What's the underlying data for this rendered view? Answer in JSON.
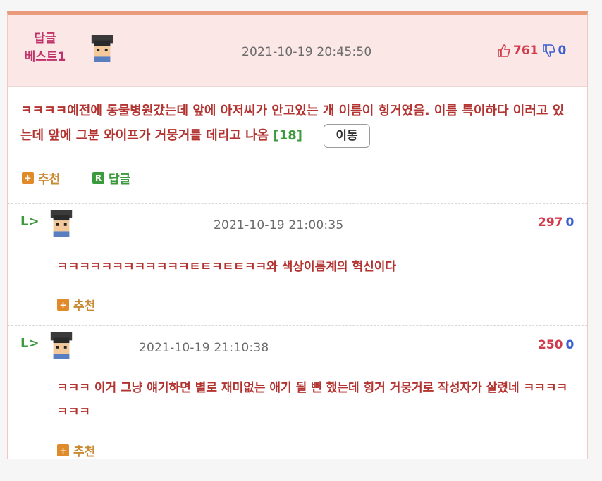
{
  "best_header": {
    "label_line1": "답글",
    "label_line2": "베스트1",
    "timestamp": "2021-10-19 20:45:50",
    "upvotes": "761",
    "downvotes": "0"
  },
  "post": {
    "text": "ㅋㅋㅋㅋ예전에 동물병원갔는데 앞에 아저씨가 안고있는 개 이름이 힝거였음. 이름 특이하다 이러고 있는데 앞에 그분 와이프가 거뭉거를 데리고 나옴",
    "reply_count": "[18]",
    "move_button": "이동",
    "recommend_label": "추천",
    "reply_label": "답글",
    "recommend_icon": "+",
    "reply_icon": "R"
  },
  "replies": [
    {
      "arrow": "L>",
      "timestamp": "2021-10-19 21:00:35",
      "upvotes": "297",
      "downvotes": "0",
      "text": "ㅋㅋㅋㅋㅋㅋㅋㅋㅋㅋㅋㅋㅌㅌㅋㅌㅌㅋㅋ와 색상이름계의 혁신이다",
      "recommend_label": "추천",
      "recommend_icon": "+"
    },
    {
      "arrow": "L>",
      "timestamp": "2021-10-19 21:10:38",
      "upvotes": "250",
      "downvotes": "0",
      "text": "ㅋㅋㅋ 이거 그냥 얘기하면 별로 재미없는 애기 될 뻔 했는데 힝거 거뭉거로 작성자가 살렸네 ㅋㅋㅋㅋㅋㅋㅋ",
      "recommend_label": "추천",
      "recommend_icon": "+"
    }
  ],
  "colors": {
    "accent_red": "#b2332f",
    "header_bg": "#fbe8e6",
    "best_label": "#c0336a",
    "green": "#3b9a3b",
    "orange": "#e08a2a"
  }
}
